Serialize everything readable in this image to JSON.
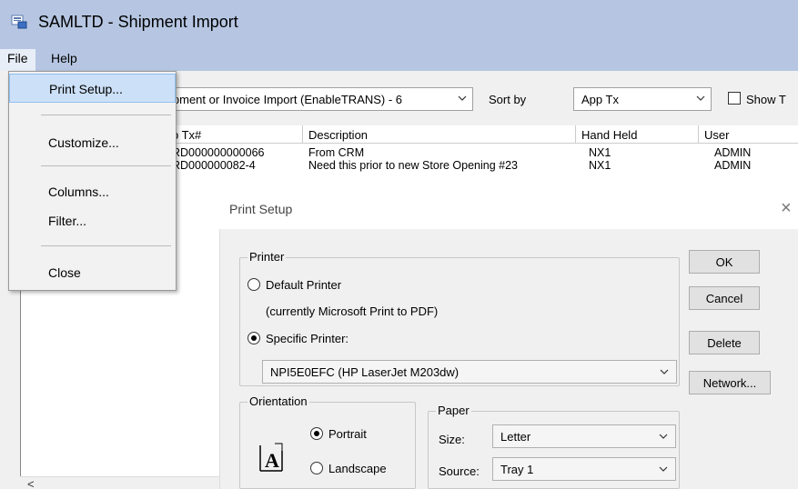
{
  "window": {
    "title": "SAMLTD - Shipment Import"
  },
  "menubar": {
    "file": "File",
    "help": "Help"
  },
  "file_menu": {
    "items": [
      {
        "label": "Print Setup..."
      },
      {
        "label": "Customize..."
      },
      {
        "label": "Columns..."
      },
      {
        "label": "Filter..."
      },
      {
        "label": "Close"
      }
    ]
  },
  "toolbar": {
    "import_type": "ipment or Invoice Import (EnableTRANS) - 6",
    "sort_by_label": "Sort by",
    "sort_by_value": "App Tx",
    "show_label": "Show T"
  },
  "grid": {
    "columns": [
      "p Tx#",
      "Description",
      "Hand Held",
      "User"
    ],
    "rows": [
      [
        "RD000000000066",
        "From CRM",
        "NX1",
        "ADMIN"
      ],
      [
        "RD000000082-4",
        "Need this prior to new Store Opening #23",
        "NX1",
        "ADMIN"
      ]
    ]
  },
  "print_setup": {
    "title": "Print Setup",
    "printer_group": "Printer",
    "default_printer": "Default Printer",
    "default_printer_note": "(currently Microsoft Print to PDF)",
    "specific_printer": "Specific Printer:",
    "specific_printer_value": "NPI5E0EFC (HP LaserJet M203dw)",
    "orientation_group": "Orientation",
    "portrait": "Portrait",
    "landscape": "Landscape",
    "paper_group": "Paper",
    "size_label": "Size:",
    "size_value": "Letter",
    "source_label": "Source:",
    "source_value": "Tray 1",
    "buttons": {
      "ok": "OK",
      "cancel": "Cancel",
      "delete": "Delete",
      "network": "Network..."
    }
  },
  "colors": {
    "titlebar": "#b6c6e2",
    "menu_highlight": "#cce0f7"
  }
}
